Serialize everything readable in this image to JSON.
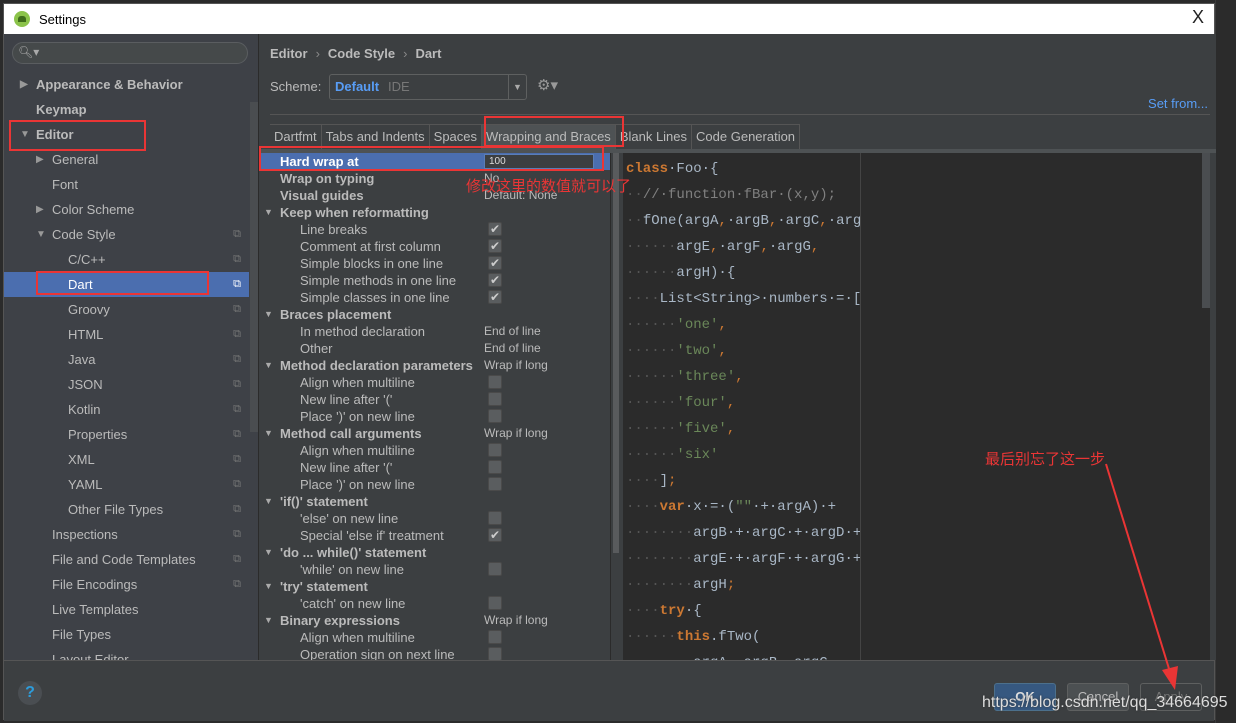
{
  "window": {
    "title": "Settings",
    "close_label": "X"
  },
  "sidebar": {
    "search_placeholder": "",
    "items": [
      {
        "label": "Appearance & Behavior",
        "level": 0,
        "arrow": "▶",
        "bold": true
      },
      {
        "label": "Keymap",
        "level": 0,
        "arrow": "",
        "bold": true
      },
      {
        "label": "Editor",
        "level": 0,
        "arrow": "▼",
        "bold": true
      },
      {
        "label": "General",
        "level": 1,
        "arrow": "▶"
      },
      {
        "label": "Font",
        "level": 1,
        "arrow": ""
      },
      {
        "label": "Color Scheme",
        "level": 1,
        "arrow": "▶"
      },
      {
        "label": "Code Style",
        "level": 1,
        "arrow": "▼",
        "copy": true
      },
      {
        "label": "C/C++",
        "level": 2,
        "copy": true
      },
      {
        "label": "Dart",
        "level": 2,
        "copy": true,
        "selected": true
      },
      {
        "label": "Groovy",
        "level": 2,
        "copy": true
      },
      {
        "label": "HTML",
        "level": 2,
        "copy": true
      },
      {
        "label": "Java",
        "level": 2,
        "copy": true
      },
      {
        "label": "JSON",
        "level": 2,
        "copy": true
      },
      {
        "label": "Kotlin",
        "level": 2,
        "copy": true
      },
      {
        "label": "Properties",
        "level": 2,
        "copy": true
      },
      {
        "label": "XML",
        "level": 2,
        "copy": true
      },
      {
        "label": "YAML",
        "level": 2,
        "copy": true
      },
      {
        "label": "Other File Types",
        "level": 2,
        "copy": true
      },
      {
        "label": "Inspections",
        "level": 1,
        "copy": true
      },
      {
        "label": "File and Code Templates",
        "level": 1,
        "copy": true
      },
      {
        "label": "File Encodings",
        "level": 1,
        "copy": true
      },
      {
        "label": "Live Templates",
        "level": 1
      },
      {
        "label": "File Types",
        "level": 1
      },
      {
        "label": "Layout Editor",
        "level": 1
      }
    ]
  },
  "breadcrumb": [
    "Editor",
    "Code Style",
    "Dart"
  ],
  "scheme": {
    "label": "Scheme:",
    "name": "Default",
    "sub": "IDE",
    "set_from": "Set from..."
  },
  "tabs": [
    {
      "label": "Dartfmt"
    },
    {
      "label": "Tabs and Indents"
    },
    {
      "label": "Spaces"
    },
    {
      "label": "Wrapping and Braces",
      "active": true
    },
    {
      "label": "Blank Lines"
    },
    {
      "label": "Code Generation"
    }
  ],
  "options": [
    {
      "label": "Hard wrap at",
      "type": "input",
      "value": "100",
      "bold": true,
      "highlight": true
    },
    {
      "label": "Wrap on typing",
      "type": "value",
      "value": "No",
      "bold": true
    },
    {
      "label": "Visual guides",
      "type": "value",
      "value": "Default: None",
      "bold": true
    },
    {
      "label": "Keep when reformatting",
      "type": "group",
      "bold": true
    },
    {
      "label": "Line breaks",
      "type": "check",
      "checked": true,
      "sub": true
    },
    {
      "label": "Comment at first column",
      "type": "check",
      "checked": true,
      "sub": true
    },
    {
      "label": "Simple blocks in one line",
      "type": "check",
      "checked": true,
      "sub": true
    },
    {
      "label": "Simple methods in one line",
      "type": "check",
      "checked": true,
      "sub": true
    },
    {
      "label": "Simple classes in one line",
      "type": "check",
      "checked": true,
      "sub": true
    },
    {
      "label": "Braces placement",
      "type": "group",
      "bold": true
    },
    {
      "label": "In method declaration",
      "type": "value",
      "value": "End of line",
      "sub": true
    },
    {
      "label": "Other",
      "type": "value",
      "value": "End of line",
      "sub": true
    },
    {
      "label": "Method declaration parameters",
      "type": "group",
      "value": "Wrap if long",
      "bold": true
    },
    {
      "label": "Align when multiline",
      "type": "check",
      "checked": false,
      "sub": true
    },
    {
      "label": "New line after '('",
      "type": "check",
      "checked": false,
      "sub": true
    },
    {
      "label": "Place ')' on new line",
      "type": "check",
      "checked": false,
      "sub": true
    },
    {
      "label": "Method call arguments",
      "type": "group",
      "value": "Wrap if long",
      "bold": true
    },
    {
      "label": "Align when multiline",
      "type": "check",
      "checked": false,
      "sub": true
    },
    {
      "label": "New line after '('",
      "type": "check",
      "checked": false,
      "sub": true
    },
    {
      "label": "Place ')' on new line",
      "type": "check",
      "checked": false,
      "sub": true
    },
    {
      "label": "'if()' statement",
      "type": "group",
      "bold": true
    },
    {
      "label": "'else' on new line",
      "type": "check",
      "checked": false,
      "sub": true
    },
    {
      "label": "Special 'else if' treatment",
      "type": "check",
      "checked": true,
      "sub": true
    },
    {
      "label": "'do ... while()' statement",
      "type": "group",
      "bold": true
    },
    {
      "label": "'while' on new line",
      "type": "check",
      "checked": false,
      "sub": true
    },
    {
      "label": "'try' statement",
      "type": "group",
      "bold": true
    },
    {
      "label": "'catch' on new line",
      "type": "check",
      "checked": false,
      "sub": true
    },
    {
      "label": "Binary expressions",
      "type": "group",
      "value": "Wrap if long",
      "bold": true
    },
    {
      "label": "Align when multiline",
      "type": "check",
      "checked": false,
      "sub": true
    },
    {
      "label": "Operation sign on next line",
      "type": "check",
      "checked": false,
      "sub": true
    }
  ],
  "code_preview": [
    [
      {
        "t": "class",
        "c": "kw"
      },
      {
        "t": "·Foo·{"
      }
    ],
    [
      {
        "t": "··",
        "c": "dot"
      },
      {
        "t": "//·function·fBar·(x,y);",
        "c": "cm"
      }
    ],
    [
      {
        "t": "··",
        "c": "dot"
      },
      {
        "t": "fOne(argA"
      },
      {
        "t": ",",
        "c": "pn"
      },
      {
        "t": "·argB"
      },
      {
        "t": ",",
        "c": "pn"
      },
      {
        "t": "·argC"
      },
      {
        "t": ",",
        "c": "pn"
      },
      {
        "t": "·argD"
      },
      {
        "t": ",",
        "c": "pn"
      }
    ],
    [
      {
        "t": "······",
        "c": "dot"
      },
      {
        "t": "argE"
      },
      {
        "t": ",",
        "c": "pn"
      },
      {
        "t": "·argF"
      },
      {
        "t": ",",
        "c": "pn"
      },
      {
        "t": "·argG"
      },
      {
        "t": ",",
        "c": "pn"
      }
    ],
    [
      {
        "t": "······",
        "c": "dot"
      },
      {
        "t": "argH)·{"
      }
    ],
    [
      {
        "t": "····",
        "c": "dot"
      },
      {
        "t": "List<String>·numbers·=·["
      }
    ],
    [
      {
        "t": "······",
        "c": "dot"
      },
      {
        "t": "'one'",
        "c": "str"
      },
      {
        "t": ",",
        "c": "pn"
      }
    ],
    [
      {
        "t": "······",
        "c": "dot"
      },
      {
        "t": "'two'",
        "c": "str"
      },
      {
        "t": ",",
        "c": "pn"
      }
    ],
    [
      {
        "t": "······",
        "c": "dot"
      },
      {
        "t": "'three'",
        "c": "str"
      },
      {
        "t": ",",
        "c": "pn"
      }
    ],
    [
      {
        "t": "······",
        "c": "dot"
      },
      {
        "t": "'four'",
        "c": "str"
      },
      {
        "t": ",",
        "c": "pn"
      }
    ],
    [
      {
        "t": "······",
        "c": "dot"
      },
      {
        "t": "'five'",
        "c": "str"
      },
      {
        "t": ",",
        "c": "pn"
      }
    ],
    [
      {
        "t": "······",
        "c": "dot"
      },
      {
        "t": "'six'",
        "c": "str"
      }
    ],
    [
      {
        "t": "····",
        "c": "dot"
      },
      {
        "t": "]"
      },
      {
        "t": ";",
        "c": "pn"
      }
    ],
    [
      {
        "t": "····",
        "c": "dot"
      },
      {
        "t": "var",
        "c": "kw"
      },
      {
        "t": "·x·=·("
      },
      {
        "t": "\"\"",
        "c": "str"
      },
      {
        "t": "·+·argA)·+"
      }
    ],
    [
      {
        "t": "········",
        "c": "dot"
      },
      {
        "t": "argB·+·argC·+·argD·+"
      }
    ],
    [
      {
        "t": "········",
        "c": "dot"
      },
      {
        "t": "argE·+·argF·+·argG·+"
      }
    ],
    [
      {
        "t": "········",
        "c": "dot"
      },
      {
        "t": "argH"
      },
      {
        "t": ";",
        "c": "pn"
      }
    ],
    [
      {
        "t": "····",
        "c": "dot"
      },
      {
        "t": "try",
        "c": "kw"
      },
      {
        "t": "·{"
      }
    ],
    [
      {
        "t": "······",
        "c": "dot"
      },
      {
        "t": "this",
        "c": "kw"
      },
      {
        "t": ".fTwo("
      }
    ],
    [
      {
        "t": "········",
        "c": "dot"
      },
      {
        "t": "argA,·argB,·argC"
      }
    ]
  ],
  "footer": {
    "help": "?",
    "ok": "OK",
    "cancel": "Cancel",
    "apply": "Apply"
  },
  "annotations": {
    "hard_wrap_note": "修改这里的数值就可以了",
    "apply_note": "最后别忘了这一步",
    "watermark": "https://blog.csdn.net/qq_34664695",
    "color": "#ea3535"
  }
}
